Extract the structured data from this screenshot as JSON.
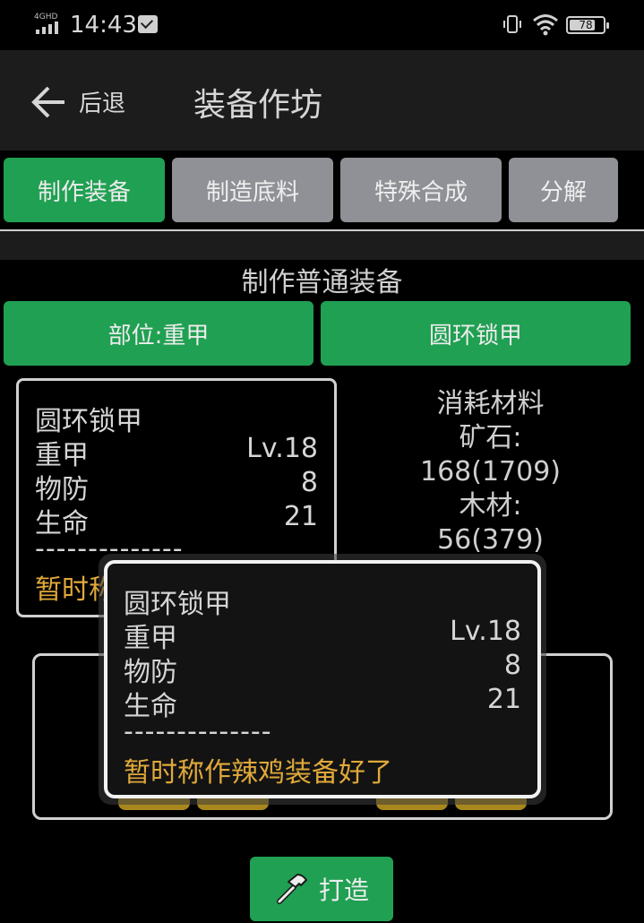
{
  "status_bar": {
    "network": "4GHD",
    "time": "14:43",
    "battery": "78",
    "battery_level": 0.78
  },
  "app_bar": {
    "back_label": "后退",
    "title": "装备作坊"
  },
  "tabs": [
    {
      "label": "制作装备",
      "active": true
    },
    {
      "label": "制造底料",
      "active": false
    },
    {
      "label": "特殊合成",
      "active": false
    },
    {
      "label": "分解",
      "active": false
    }
  ],
  "section_title": "制作普通装备",
  "selectors": {
    "slot": "部位:重甲",
    "item": "圆环锁甲"
  },
  "item_card": {
    "name": "圆环锁甲",
    "type": "重甲",
    "level": "Lv.18",
    "stats": [
      {
        "label": "物防",
        "value": "8"
      },
      {
        "label": "生命",
        "value": "21"
      }
    ],
    "separator": "--------------",
    "description": "暂时称作辣鸡装备好了"
  },
  "materials": {
    "title": "消耗材料",
    "items": [
      {
        "label": "矿石:",
        "value": "168(1709)"
      },
      {
        "label": "木材:",
        "value": "56(379)"
      }
    ]
  },
  "forge_button": {
    "label": "打造",
    "icon": "hammer-icon"
  },
  "colors": {
    "primary_green": "#20a052",
    "inactive_tab": "#8f9196",
    "description_orange": "#e0a93a"
  }
}
